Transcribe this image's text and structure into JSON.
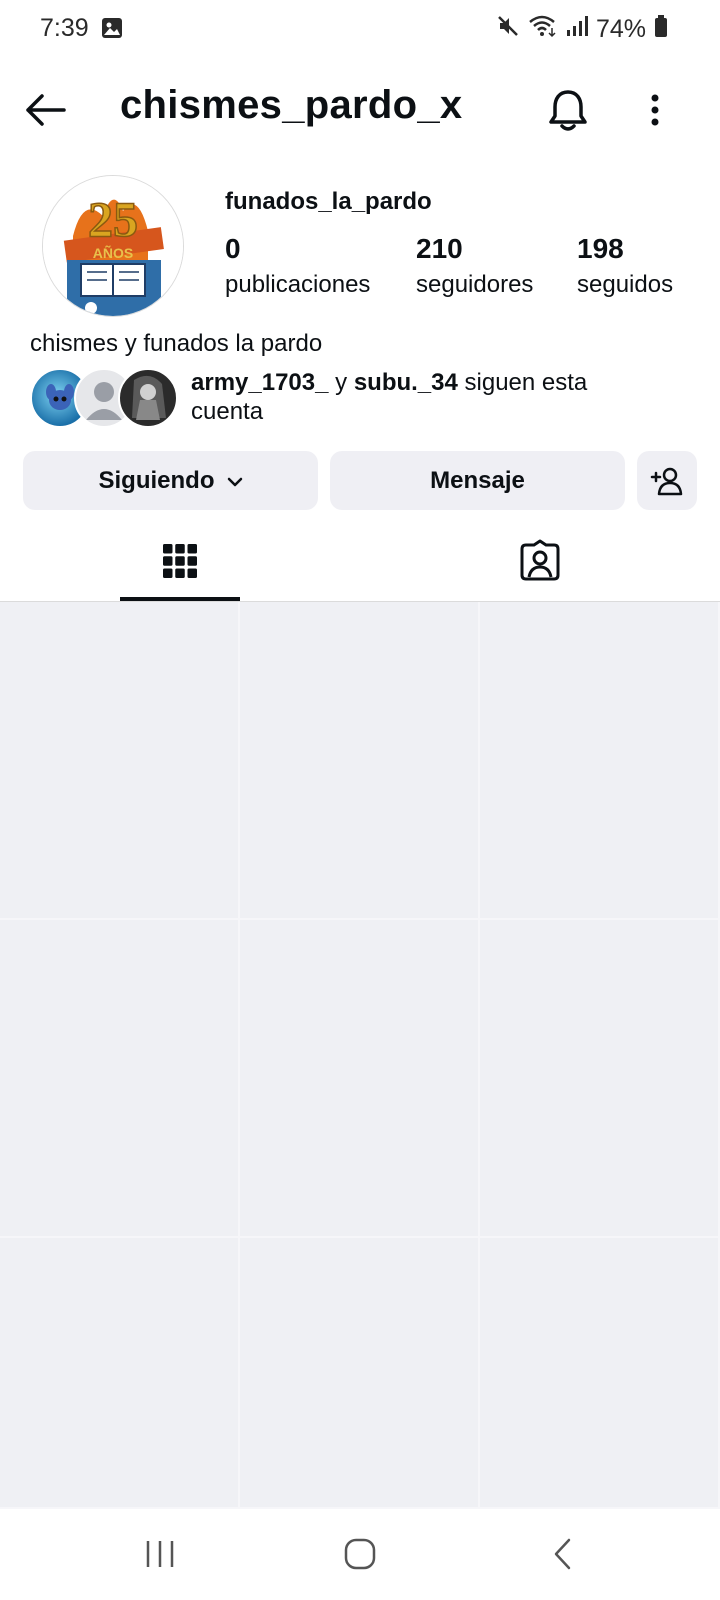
{
  "status_bar": {
    "time": "7:39",
    "battery": "74%"
  },
  "header": {
    "username": "chismes_pardo_x"
  },
  "profile": {
    "display_name": "funados_la_pardo",
    "posts_count": "0",
    "posts_label": "publicaciones",
    "followers_count": "210",
    "followers_label": "seguidores",
    "following_count": "198",
    "following_label": "seguidos",
    "bio": "chismes y funados la pardo",
    "avatar_text": "25 AÑOS"
  },
  "mutuals": {
    "user1": "army_1703_",
    "connector": " y ",
    "user2": "subu._34",
    "suffix": " siguen esta cuenta"
  },
  "actions": {
    "following_label": "Siguiendo",
    "message_label": "Mensaje"
  },
  "icons": {
    "back": "arrow-left-icon",
    "bell": "bell-icon",
    "more": "more-vertical-icon",
    "grid": "grid-icon",
    "tagged": "tagged-person-icon",
    "add_person": "add-person-icon"
  },
  "colors": {
    "button_bg": "#efeff4",
    "grid_bg": "#eff0f4",
    "text": "#0c1014"
  }
}
